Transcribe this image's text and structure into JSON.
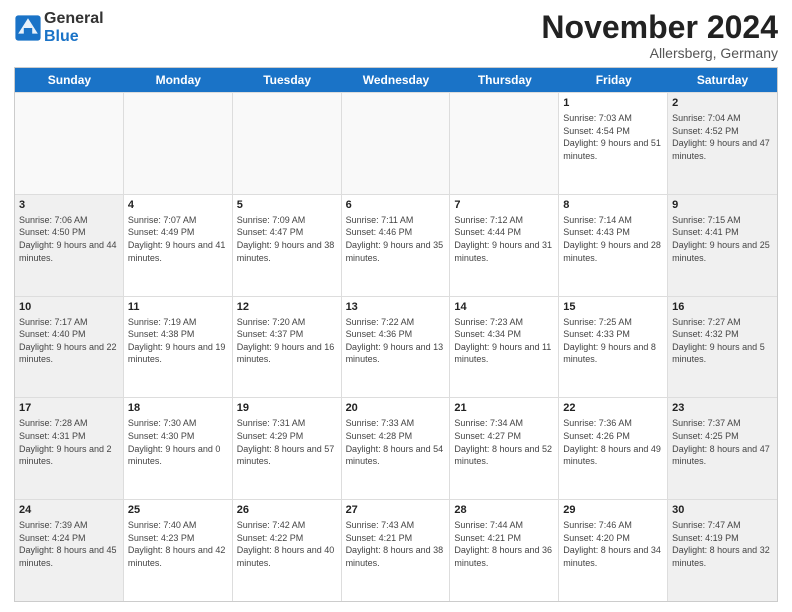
{
  "logo": {
    "line1": "General",
    "line2": "Blue"
  },
  "title": "November 2024",
  "location": "Allersberg, Germany",
  "days_of_week": [
    "Sunday",
    "Monday",
    "Tuesday",
    "Wednesday",
    "Thursday",
    "Friday",
    "Saturday"
  ],
  "weeks": [
    [
      {
        "day": "",
        "info": "",
        "empty": true
      },
      {
        "day": "",
        "info": "",
        "empty": true
      },
      {
        "day": "",
        "info": "",
        "empty": true
      },
      {
        "day": "",
        "info": "",
        "empty": true
      },
      {
        "day": "",
        "info": "",
        "empty": true
      },
      {
        "day": "1",
        "info": "Sunrise: 7:03 AM\nSunset: 4:54 PM\nDaylight: 9 hours\nand 51 minutes."
      },
      {
        "day": "2",
        "info": "Sunrise: 7:04 AM\nSunset: 4:52 PM\nDaylight: 9 hours\nand 47 minutes."
      }
    ],
    [
      {
        "day": "3",
        "info": "Sunrise: 7:06 AM\nSunset: 4:50 PM\nDaylight: 9 hours\nand 44 minutes."
      },
      {
        "day": "4",
        "info": "Sunrise: 7:07 AM\nSunset: 4:49 PM\nDaylight: 9 hours\nand 41 minutes."
      },
      {
        "day": "5",
        "info": "Sunrise: 7:09 AM\nSunset: 4:47 PM\nDaylight: 9 hours\nand 38 minutes."
      },
      {
        "day": "6",
        "info": "Sunrise: 7:11 AM\nSunset: 4:46 PM\nDaylight: 9 hours\nand 35 minutes."
      },
      {
        "day": "7",
        "info": "Sunrise: 7:12 AM\nSunset: 4:44 PM\nDaylight: 9 hours\nand 31 minutes."
      },
      {
        "day": "8",
        "info": "Sunrise: 7:14 AM\nSunset: 4:43 PM\nDaylight: 9 hours\nand 28 minutes."
      },
      {
        "day": "9",
        "info": "Sunrise: 7:15 AM\nSunset: 4:41 PM\nDaylight: 9 hours\nand 25 minutes."
      }
    ],
    [
      {
        "day": "10",
        "info": "Sunrise: 7:17 AM\nSunset: 4:40 PM\nDaylight: 9 hours\nand 22 minutes."
      },
      {
        "day": "11",
        "info": "Sunrise: 7:19 AM\nSunset: 4:38 PM\nDaylight: 9 hours\nand 19 minutes."
      },
      {
        "day": "12",
        "info": "Sunrise: 7:20 AM\nSunset: 4:37 PM\nDaylight: 9 hours\nand 16 minutes."
      },
      {
        "day": "13",
        "info": "Sunrise: 7:22 AM\nSunset: 4:36 PM\nDaylight: 9 hours\nand 13 minutes."
      },
      {
        "day": "14",
        "info": "Sunrise: 7:23 AM\nSunset: 4:34 PM\nDaylight: 9 hours\nand 11 minutes."
      },
      {
        "day": "15",
        "info": "Sunrise: 7:25 AM\nSunset: 4:33 PM\nDaylight: 9 hours\nand 8 minutes."
      },
      {
        "day": "16",
        "info": "Sunrise: 7:27 AM\nSunset: 4:32 PM\nDaylight: 9 hours\nand 5 minutes."
      }
    ],
    [
      {
        "day": "17",
        "info": "Sunrise: 7:28 AM\nSunset: 4:31 PM\nDaylight: 9 hours\nand 2 minutes."
      },
      {
        "day": "18",
        "info": "Sunrise: 7:30 AM\nSunset: 4:30 PM\nDaylight: 9 hours\nand 0 minutes."
      },
      {
        "day": "19",
        "info": "Sunrise: 7:31 AM\nSunset: 4:29 PM\nDaylight: 8 hours\nand 57 minutes."
      },
      {
        "day": "20",
        "info": "Sunrise: 7:33 AM\nSunset: 4:28 PM\nDaylight: 8 hours\nand 54 minutes."
      },
      {
        "day": "21",
        "info": "Sunrise: 7:34 AM\nSunset: 4:27 PM\nDaylight: 8 hours\nand 52 minutes."
      },
      {
        "day": "22",
        "info": "Sunrise: 7:36 AM\nSunset: 4:26 PM\nDaylight: 8 hours\nand 49 minutes."
      },
      {
        "day": "23",
        "info": "Sunrise: 7:37 AM\nSunset: 4:25 PM\nDaylight: 8 hours\nand 47 minutes."
      }
    ],
    [
      {
        "day": "24",
        "info": "Sunrise: 7:39 AM\nSunset: 4:24 PM\nDaylight: 8 hours\nand 45 minutes."
      },
      {
        "day": "25",
        "info": "Sunrise: 7:40 AM\nSunset: 4:23 PM\nDaylight: 8 hours\nand 42 minutes."
      },
      {
        "day": "26",
        "info": "Sunrise: 7:42 AM\nSunset: 4:22 PM\nDaylight: 8 hours\nand 40 minutes."
      },
      {
        "day": "27",
        "info": "Sunrise: 7:43 AM\nSunset: 4:21 PM\nDaylight: 8 hours\nand 38 minutes."
      },
      {
        "day": "28",
        "info": "Sunrise: 7:44 AM\nSunset: 4:21 PM\nDaylight: 8 hours\nand 36 minutes."
      },
      {
        "day": "29",
        "info": "Sunrise: 7:46 AM\nSunset: 4:20 PM\nDaylight: 8 hours\nand 34 minutes."
      },
      {
        "day": "30",
        "info": "Sunrise: 7:47 AM\nSunset: 4:19 PM\nDaylight: 8 hours\nand 32 minutes."
      }
    ]
  ]
}
